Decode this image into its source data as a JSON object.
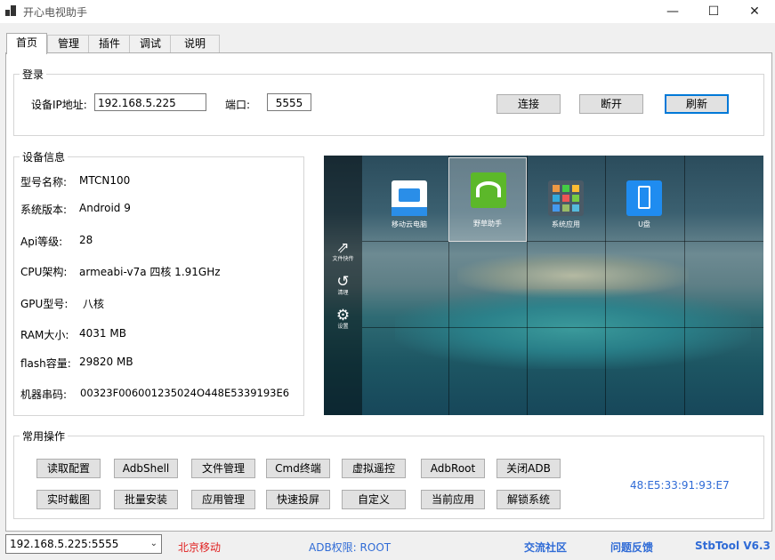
{
  "window": {
    "title": "开心电视助手",
    "controls": [
      "—",
      "☐",
      "✕"
    ]
  },
  "tabs": [
    "首页",
    "管理",
    "插件",
    "调试",
    "说明"
  ],
  "login": {
    "group_title": "登录",
    "ip_label": "设备IP地址:",
    "ip_value": "192.168.5.225",
    "port_label": "端口:",
    "port_value": "5555",
    "connect": "连接",
    "disconnect": "断开",
    "refresh": "刷新"
  },
  "device_info": {
    "group_title": "设备信息",
    "rows": [
      {
        "label": "型号名称:",
        "value": "MTCN100"
      },
      {
        "label": "系统版本:",
        "value": "Android 9"
      },
      {
        "label": "Api等级:",
        "value": "28"
      },
      {
        "label": "CPU架构:",
        "value": "armeabi-v7a 四核 1.91GHz"
      },
      {
        "label": "GPU型号:",
        "value": "八核"
      },
      {
        "label": "RAM大小:",
        "value": "4031 MB"
      },
      {
        "label": "flash容量:",
        "value": "29820 MB"
      },
      {
        "label": "机器串码:",
        "value": "00323F006001235024O448E5339193E6"
      }
    ]
  },
  "tv_screen": {
    "sidebar": [
      {
        "icon": "file-transfer-icon",
        "label": "文件快传"
      },
      {
        "icon": "clean-icon",
        "label": "清理"
      },
      {
        "icon": "settings-icon",
        "label": "设置"
      }
    ],
    "apps": [
      {
        "label": "移动云电脑",
        "color": "#ffffff",
        "accent": "#2a8ee8"
      },
      {
        "label": "野草助手",
        "color": "#5cb82a",
        "accent": "#ffffff"
      },
      {
        "label": "系统应用",
        "color": "#4a5a66",
        "accent": "#e94"
      },
      {
        "label": "U盘",
        "color": "#1f8cf0",
        "accent": "#ffffff"
      }
    ]
  },
  "common_ops": {
    "group_title": "常用操作",
    "row1": [
      "读取配置",
      "AdbShell",
      "文件管理",
      "Cmd终端",
      "虚拟遥控",
      "AdbRoot",
      "关闭ADB"
    ],
    "row2": [
      "实时截图",
      "批量安装",
      "应用管理",
      "快速投屏",
      "自定义",
      "当前应用",
      "解锁系统"
    ],
    "mac": "48:E5:33:91:93:E7"
  },
  "statusbar": {
    "device_select": "192.168.5.225:5555",
    "operator": "北京移动",
    "adb_permission": "ADB权限: ROOT",
    "community": "交流社区",
    "feedback": "问题反馈",
    "version": "StbTool V6.3"
  },
  "colors": {
    "link_blue": "#2f6bd6",
    "operator_red": "#e02020",
    "accent": "#0078d7"
  }
}
